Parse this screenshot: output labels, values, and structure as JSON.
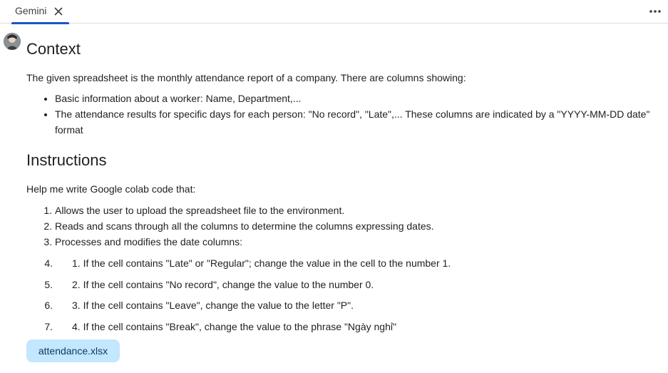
{
  "tab": {
    "label": "Gemini"
  },
  "context": {
    "heading": "Context",
    "intro": "The given spreadsheet is the monthly attendance report of a company. There are columns showing:",
    "bullets": [
      "Basic information about a worker: Name, Department,...",
      "The attendance results for specific days for each person: \"No record\", \"Late\",... These columns are indicated by a \"YYYY-MM-DD date\" format"
    ]
  },
  "instructions": {
    "heading": "Instructions",
    "intro": "Help me write Google colab code that:",
    "steps": [
      "Allows the user to upload the spreadsheet file to the environment.",
      "Reads and scans through all the columns to determine the columns expressing dates.",
      "Processes and modifies the date columns:"
    ],
    "sub_steps": [
      {
        "num": "4.",
        "text": "1. If the cell contains \"Late\" or \"Regular\"; change the value in the cell to the number 1."
      },
      {
        "num": "5.",
        "text": "2. If the cell contains \"No record\", change the value to the number 0."
      },
      {
        "num": "6.",
        "text": "3. If the cell contains \"Leave\", change the value to the letter \"P\"."
      },
      {
        "num": "7.",
        "text": "4. If the cell contains \"Break\", change the value to the phrase \"Ngày nghỉ\""
      }
    ]
  },
  "attachment": {
    "filename": "attendance.xlsx"
  },
  "colors": {
    "accent": "#1a56c6",
    "chip_bg": "#c2e7ff"
  }
}
